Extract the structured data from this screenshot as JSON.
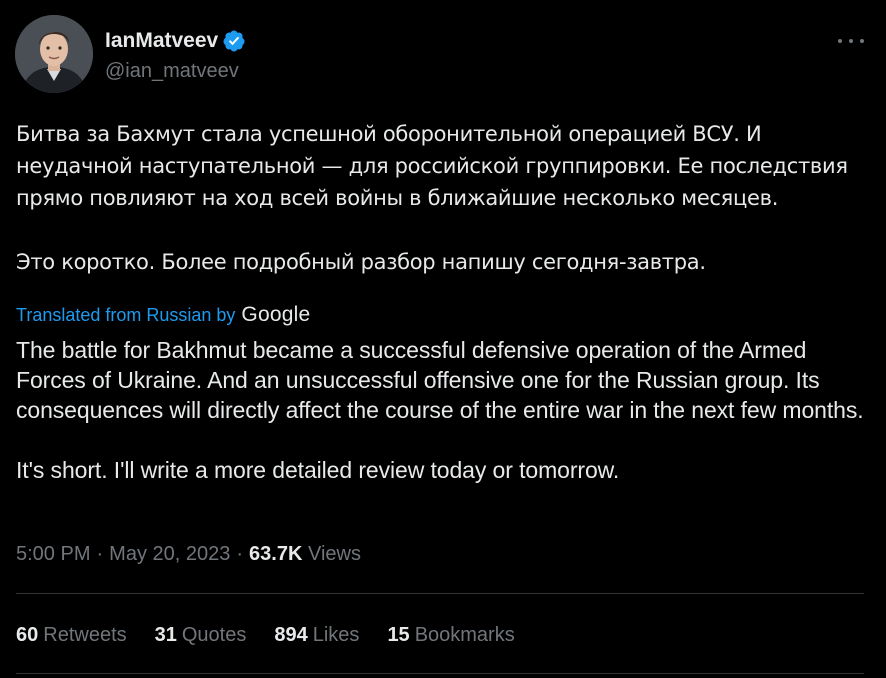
{
  "author": {
    "display_name": "IanMatveev",
    "handle": "@ian_matveev",
    "verified_color": "#1d9bf0"
  },
  "tweet": {
    "original_paragraphs": [
      "Битва за Бахмут стала успешной оборонительной операцией ВСУ. И неудачной наступательной — для российской группировки. Ее последствия прямо повлияют на ход всей войны в ближайшие несколько месяцев.",
      "Это коротко. Более подробный разбор напишу сегодня-завтра."
    ],
    "translated_label": "Translated from Russian by",
    "translator_brand": "Google",
    "translated_paragraphs": [
      "The battle for Bakhmut became a successful defensive operation of the Armed Forces of Ukraine. And an unsuccessful offensive one for the Russian group. Its consequences will directly affect the course of the entire war in the next few months.",
      "It's short. I'll write a more detailed review today or tomorrow."
    ]
  },
  "meta": {
    "time": "5:00 PM",
    "separator": "·",
    "date": "May 20, 2023",
    "views_count": "63.7K",
    "views_label": "Views"
  },
  "stats": [
    {
      "count": "60",
      "label": "Retweets"
    },
    {
      "count": "31",
      "label": "Quotes"
    },
    {
      "count": "894",
      "label": "Likes"
    },
    {
      "count": "15",
      "label": "Bookmarks"
    }
  ],
  "colors": {
    "background": "#000000",
    "text": "#e7e9ea",
    "muted": "#71767b",
    "accent": "#1d9bf0",
    "divider": "#2f3336"
  },
  "icons": {
    "verified": "verified-badge-icon",
    "more": "more-dots-icon"
  }
}
